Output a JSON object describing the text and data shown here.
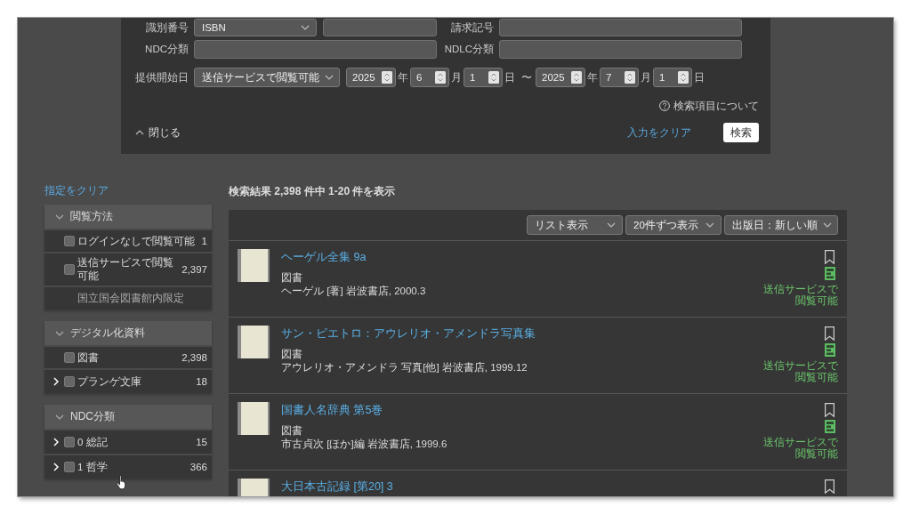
{
  "search_form": {
    "field_rows": [
      [
        {
          "label": "識別番号",
          "kind": "select-input",
          "value": "ISBN"
        },
        {
          "label": "請求記号",
          "kind": "input"
        }
      ],
      [
        {
          "label": "NDC分類",
          "kind": "input"
        },
        {
          "label": "NDLC分類",
          "kind": "input"
        }
      ]
    ],
    "date_range": {
      "label": "提供開始日",
      "mode": "送信サービスで閲覧可能",
      "from": [
        {
          "value": "2025",
          "unit": "年"
        },
        {
          "value": "6",
          "unit": "月"
        },
        {
          "value": "1",
          "unit": "日"
        }
      ],
      "separator": "〜",
      "to": [
        {
          "value": "2025",
          "unit": "年"
        },
        {
          "value": "7",
          "unit": "月"
        },
        {
          "value": "1",
          "unit": "日"
        }
      ]
    },
    "help_link": "検索項目について",
    "collapse_button": "閉じる",
    "clear_link": "入力をクリア",
    "search_button": "検索"
  },
  "sidebar": {
    "clear_link": "指定をクリア",
    "facets": [
      {
        "title": "閲覧方法",
        "expanded": true,
        "items": [
          {
            "kind": "checkbox",
            "label": "ログインなしで閲覧可能",
            "count": "1",
            "checked": false
          },
          {
            "kind": "checkbox",
            "label": "送信サービスで閲覧可能",
            "count": "2,397",
            "checked": false
          },
          {
            "kind": "note",
            "label": "国立国会図書館内限定"
          }
        ]
      },
      {
        "title": "デジタル化資料",
        "expanded": true,
        "items": [
          {
            "kind": "checkbox",
            "label": "図書",
            "count": "2,398",
            "checked": false
          },
          {
            "kind": "tree",
            "label": "プランゲ文庫",
            "count": "18",
            "checked": false,
            "expanded": false
          }
        ]
      },
      {
        "title": "NDC分類",
        "expanded": true,
        "items": [
          {
            "kind": "tree",
            "label": "0 総記",
            "count": "15",
            "checked": false,
            "expanded": false
          },
          {
            "kind": "tree",
            "label": "1 哲学",
            "count": "366",
            "checked": false,
            "expanded": false
          }
        ]
      }
    ]
  },
  "results": {
    "summary": "検索結果 2,398 件中 1-20 件を表示",
    "view_selects": [
      "リスト表示",
      "20件ずつ表示",
      "出版日：新しい順"
    ],
    "items": [
      {
        "title": "ヘーゲル全集 9a",
        "type": "図書",
        "meta": "ヘーゲル [著] 岩波書店, 2000.3",
        "availability": "送信サービスで閲覧可能",
        "bookmarked": false
      },
      {
        "title": "サン・ピエトロ：アウレリオ・アメンドラ写真集",
        "type": "図書",
        "meta": "アウレリオ・アメンドラ 写真[他] 岩波書店, 1999.12",
        "availability": "送信サービスで閲覧可能",
        "bookmarked": false
      },
      {
        "title": "国書人名辞典 第5巻",
        "type": "図書",
        "meta": "市古貞次 [ほか]編 岩波書店, 1999.6",
        "availability": "送信サービスで閲覧可能",
        "bookmarked": false
      },
      {
        "title": "大日本古記録 [第20] 3",
        "bookmarked": false
      }
    ]
  }
}
